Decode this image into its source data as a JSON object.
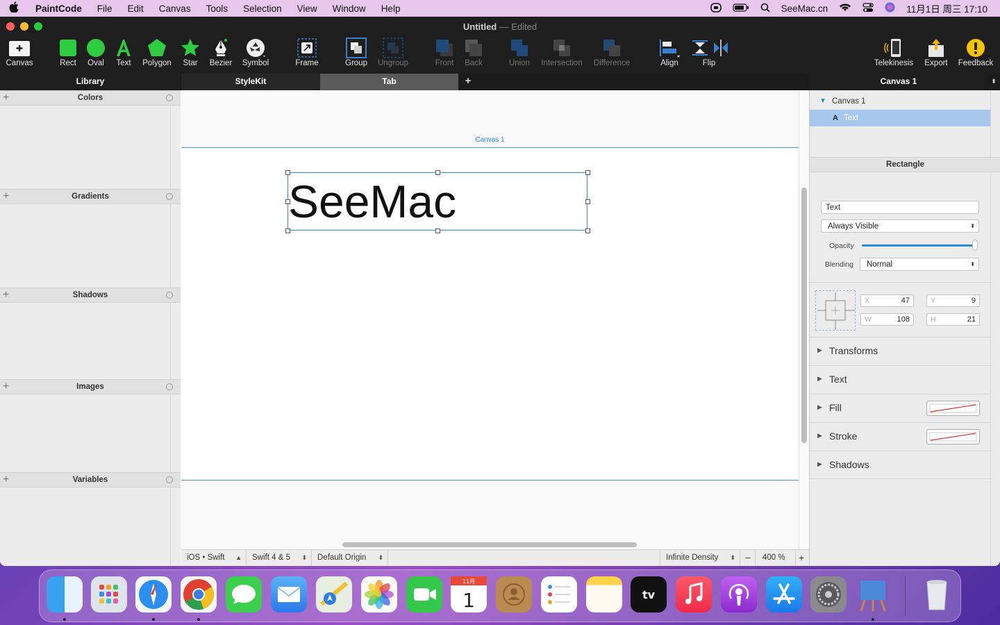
{
  "menubar": {
    "app_name": "PaintCode",
    "items": [
      "File",
      "Edit",
      "Canvas",
      "Tools",
      "Selection",
      "View",
      "Window",
      "Help"
    ],
    "site": "SeeMac.cn",
    "datetime": "11月1日 周三  17:10"
  },
  "window": {
    "title": "Untitled",
    "title_sep": "—",
    "title_status": "Edited"
  },
  "toolbar": {
    "canvas": "Canvas",
    "rect": "Rect",
    "oval": "Oval",
    "text": "Text",
    "polygon": "Polygon",
    "star": "Star",
    "bezier": "Bezier",
    "symbol": "Symbol",
    "frame": "Frame",
    "group": "Group",
    "ungroup": "Ungroup",
    "front": "Front",
    "back": "Back",
    "union": "Union",
    "intersection": "Intersection",
    "difference": "Difference",
    "align": "Align",
    "flip": "Flip",
    "telekinesis": "Telekinesis",
    "export": "Export",
    "feedback": "Feedback",
    "accent": "#2ecc40"
  },
  "tabbar": {
    "library": "Library",
    "stylekit": "StyleKit",
    "tab": "Tab",
    "add": "+",
    "canvas_title": "Canvas 1"
  },
  "library": {
    "sections": [
      "Colors",
      "Gradients",
      "Shadows",
      "Images",
      "Variables"
    ]
  },
  "canvas": {
    "label": "Canvas 1",
    "text_content": "SeeMac",
    "accent": "#2a8ad4"
  },
  "bottombar": {
    "platform": "iOS • Swift",
    "language": "Swift 4 & 5",
    "origin": "Default Origin",
    "density": "Infinite Density",
    "minus": "−",
    "zoom": "400 %",
    "plus": "+"
  },
  "inspector": {
    "tree": {
      "canvas": "Canvas 1",
      "text": "Text"
    },
    "header": "Rectangle",
    "name_value": "Text",
    "visibility": "Always Visible",
    "opacity_label": "Opacity",
    "opacity": 1.0,
    "blending_label": "Blending",
    "blending": "Normal",
    "x_label": "X",
    "x": "47",
    "y_label": "Y",
    "y": "9",
    "w_label": "W",
    "w": "108",
    "h_label": "H",
    "h": "21",
    "sections": [
      "Transforms",
      "Text",
      "Fill",
      "Stroke",
      "Shadows"
    ]
  }
}
